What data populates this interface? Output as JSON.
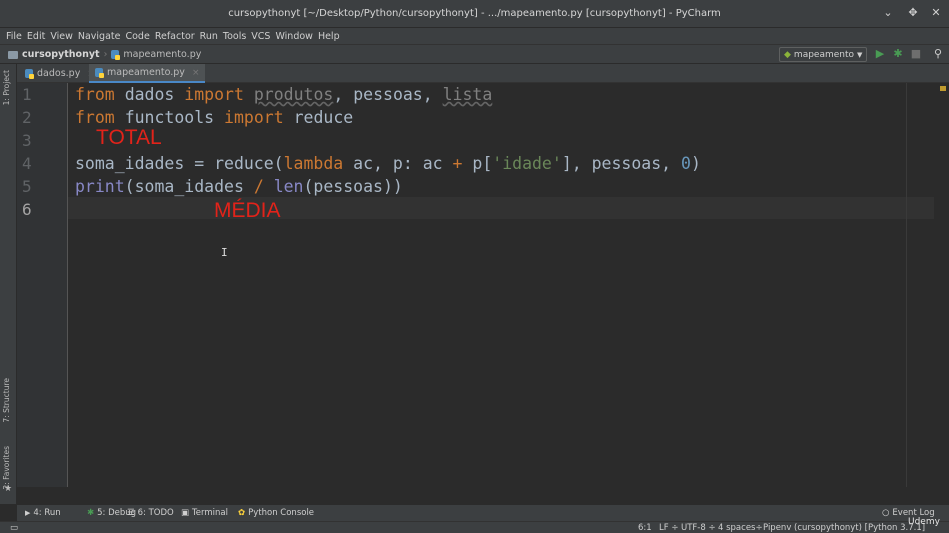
{
  "window": {
    "title": "cursopythonyt [~/Desktop/Python/cursopythonyt] - .../mapeamento.py [cursopythonyt] - PyCharm"
  },
  "menu": [
    "File",
    "Edit",
    "View",
    "Navigate",
    "Code",
    "Refactor",
    "Run",
    "Tools",
    "VCS",
    "Window",
    "Help"
  ],
  "navbar": {
    "project": "cursopythonyt",
    "file": "mapeamento.py",
    "run_config": "mapeamento"
  },
  "left_strip": {
    "project_tab": "1: Project",
    "structure_tab": "7: Structure",
    "favorites_tab": "2: Favorites"
  },
  "tabs": [
    {
      "label": "dados.py",
      "active": false
    },
    {
      "label": "mapeamento.py",
      "active": true
    }
  ],
  "editor": {
    "line_numbers": [
      "1",
      "2",
      "3",
      "4",
      "5",
      "6"
    ],
    "current_line": "6",
    "code": {
      "l1": {
        "from": "from",
        "mod": "dados",
        "import": "import",
        "a": "produtos",
        "sep1": ",",
        "b": "pessoas",
        "sep2": ",",
        "c": "lista"
      },
      "l2": {
        "from": "from",
        "mod": "functools",
        "import": "import",
        "name": "reduce"
      },
      "l4": {
        "p1": "soma_idades = reduce(",
        "lambda": "lambda",
        "p2": " ac, p: ac ",
        "plus": "+",
        "p3": " p[",
        "str": "'idade'",
        "p4": "], pessoas, ",
        "zero": "0",
        "p5": ")"
      },
      "l5": {
        "print": "print",
        "p1": "(soma_idades ",
        "div": "/",
        "sp": " ",
        "len": "len",
        "p2": "(pessoas))"
      }
    },
    "annotations": {
      "total": "TOTAL",
      "media": "MÉDIA"
    }
  },
  "toolwindows": [
    {
      "label": "4: Run",
      "icon": "play-icon"
    },
    {
      "label": "5: Debug",
      "icon": "bug-icon"
    },
    {
      "label": "6: TODO",
      "icon": "list-icon"
    },
    {
      "label": "Terminal",
      "icon": "terminal-icon"
    },
    {
      "label": "Python Console",
      "icon": "python-icon"
    },
    {
      "label": "Event Log",
      "icon": "event-log-icon"
    }
  ],
  "status": {
    "position": "6:1",
    "line_sep": "LF ÷",
    "encoding": "UTF-8 ÷",
    "indent": "4 spaces÷",
    "interpreter": "Pipenv (cursopythonyt) [Python 3.7.1]"
  },
  "watermark": "Udemy"
}
